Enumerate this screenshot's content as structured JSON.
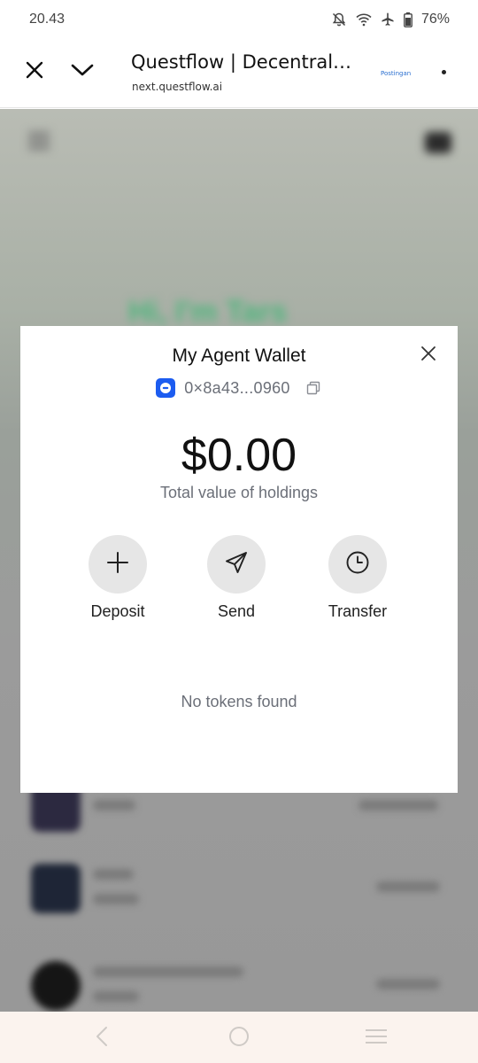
{
  "status_bar": {
    "time": "20.43",
    "battery": "76%",
    "icons": [
      "notifications-off-icon",
      "wifi-icon",
      "airplane-icon",
      "battery-icon"
    ]
  },
  "browser": {
    "title": "Questflow | Decentraliz...",
    "url": "next.questflow.ai",
    "badge": "Postingan",
    "icons": [
      "close-icon",
      "chevron-down-icon",
      "more-vertical-icon"
    ]
  },
  "background": {
    "greeting": "Hi, I'm Tars"
  },
  "modal": {
    "title": "My Agent Wallet",
    "address": "0×8a43...0960",
    "balance": "$0.00",
    "balance_caption": "Total value of holdings",
    "actions": [
      {
        "label": "Deposit",
        "icon": "plus-icon"
      },
      {
        "label": "Send",
        "icon": "send-icon"
      },
      {
        "label": "Transfer",
        "icon": "clock-icon"
      }
    ],
    "empty_message": "No tokens found"
  },
  "nav_bar": {
    "icons": [
      "back-icon",
      "home-icon",
      "recents-icon"
    ]
  },
  "colors": {
    "accent": "#1c5cf0",
    "action_bg": "#e6e6e6",
    "muted_text": "#6b6f78",
    "nav_bg": "#fbf3ee"
  }
}
